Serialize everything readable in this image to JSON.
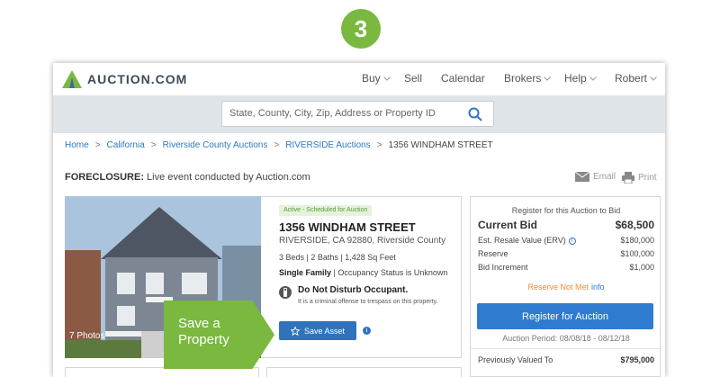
{
  "step_number": "3",
  "brand": {
    "name": "AUCTION.COM",
    "colors": {
      "green": "#7ab83f",
      "blue": "#2f73bd",
      "dark_blue": "#3d4b57"
    }
  },
  "nav": {
    "buy": "Buy",
    "sell": "Sell",
    "calendar": "Calendar",
    "brokers": "Brokers",
    "help": "Help",
    "user": "Robert"
  },
  "search": {
    "placeholder": "State, County, City, Zip, Address or Property ID",
    "icon": "search-icon"
  },
  "breadcrumb": {
    "items": [
      "Home",
      "California",
      "Riverside County Auctions",
      "RIVERSIDE Auctions"
    ],
    "separator": ">",
    "current": "1356 WINDHAM STREET"
  },
  "event": {
    "label": "FORECLOSURE:",
    "text": " Live event conducted by Auction.com"
  },
  "share": {
    "email": "Email",
    "print": "Print"
  },
  "photo": {
    "count_label": "7 Photos"
  },
  "property": {
    "status": "Active - Scheduled for Auction",
    "address": "1356 WINDHAM STREET",
    "city_line": "RIVERSIDE, CA 92880, Riverside County",
    "specs": "3 Beds | 2 Baths | 1,428 Sq Feet",
    "type": "Single Family",
    "occupancy": " | Occupancy Status is Unknown",
    "dnd_title": "Do Not Disturb Occupant.",
    "dnd_text": "It is a criminal offense to trespass on this property.",
    "save_label": "Save Asset"
  },
  "callout": {
    "line1": "Save a",
    "line2": "Property"
  },
  "bid": {
    "register_text": "Register for this Auction to Bid",
    "current_bid_label": "Current Bid",
    "current_bid_value": "$68,500",
    "erv_label": "Est. Resale Value (ERV)",
    "erv_value": "$180,000",
    "reserve_label": "Reserve",
    "reserve_value": "$100,000",
    "increment_label": "Bid Increment",
    "increment_value": "$1,000",
    "reserve_status": "Reserve Not Met",
    "info_link": "info",
    "register_button": "Register for Auction",
    "auction_period": "Auction Period: 08/08/18 - 08/12/18",
    "prev_valued_label": "Previously Valued To",
    "prev_valued_value": "$795,000"
  }
}
